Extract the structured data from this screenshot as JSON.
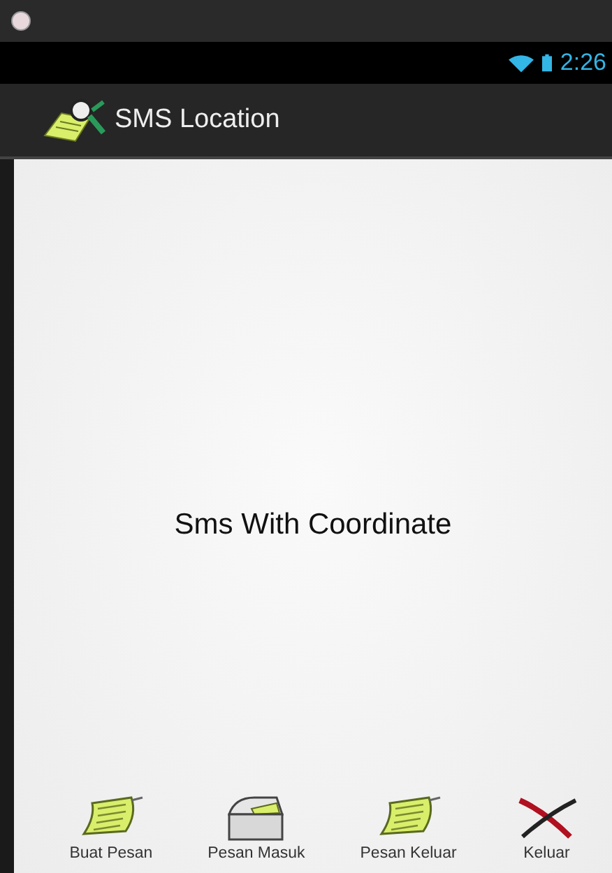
{
  "status_bar": {
    "time": "2:26"
  },
  "action_bar": {
    "title": "SMS Location"
  },
  "content": {
    "heading": "Sms With Coordinate"
  },
  "buttons": [
    {
      "label": "Buat Pesan",
      "kind": "paper"
    },
    {
      "label": "Pesan Masuk",
      "kind": "inbox"
    },
    {
      "label": "Pesan Keluar",
      "kind": "paper"
    },
    {
      "label": "Keluar",
      "kind": "exit"
    }
  ]
}
